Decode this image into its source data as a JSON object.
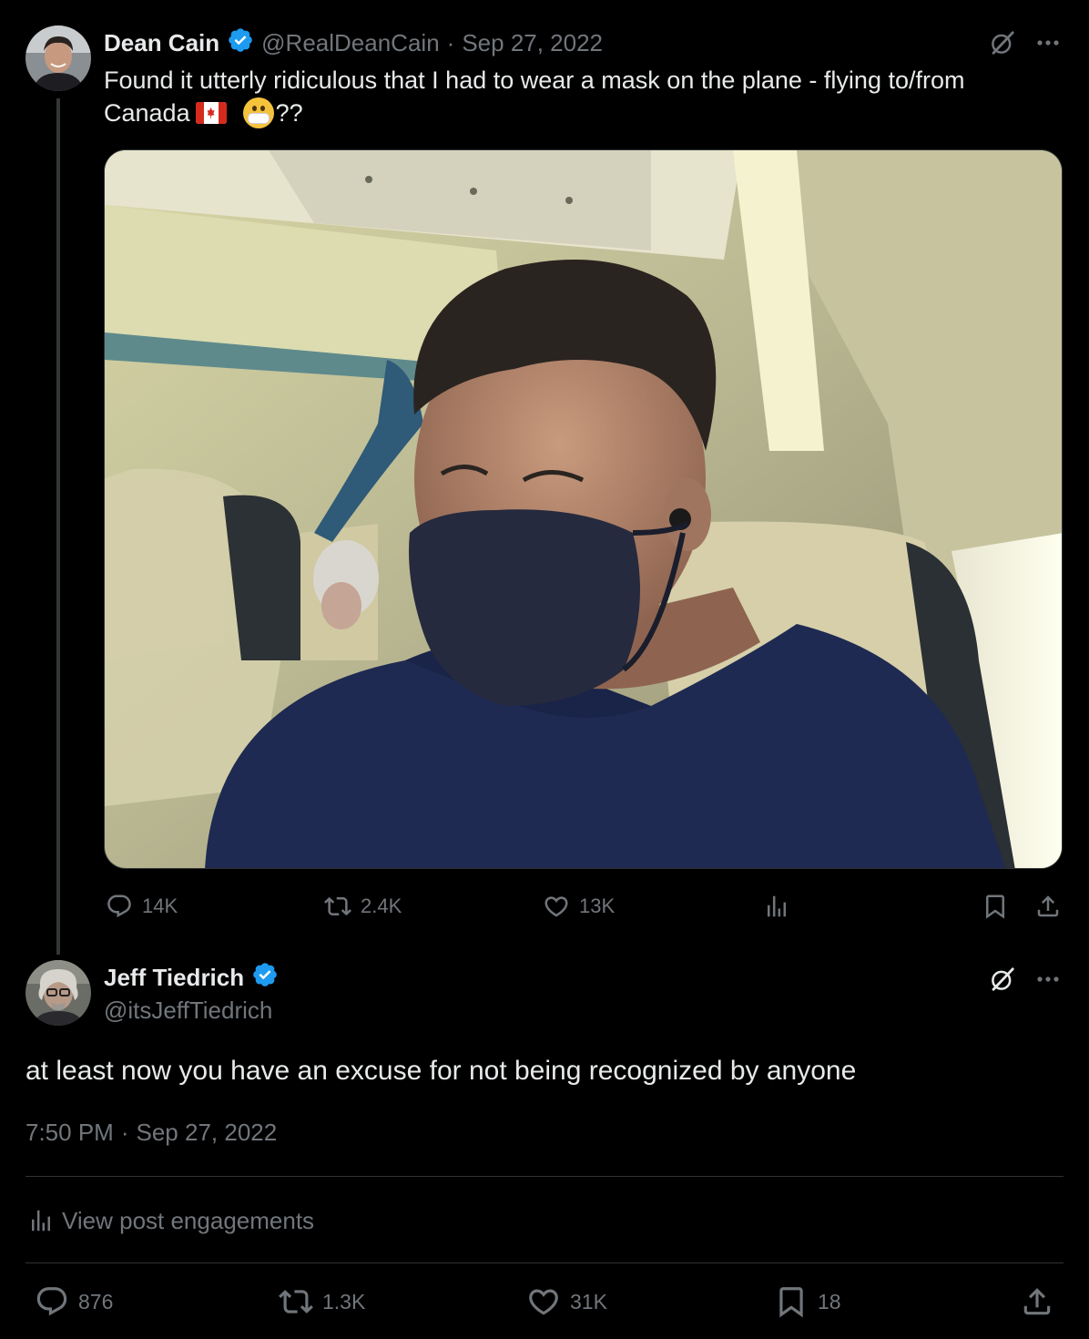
{
  "parent_tweet": {
    "display_name": "Dean Cain",
    "handle": "@RealDeanCain",
    "separator": "·",
    "date": "Sep 27, 2022",
    "text_line1": "Found it utterly ridiculous that I had to wear a mask on the plane - flying to/from",
    "text_line2_prefix": "Canada",
    "text_line2_suffix": "??",
    "actions": {
      "replies": "14K",
      "reposts": "2.4K",
      "likes": "13K"
    }
  },
  "reply_tweet": {
    "display_name": "Jeff Tiedrich",
    "handle": "@itsJeffTiedrich",
    "text": "at least now you have an excuse for not being recognized by anyone",
    "time": "7:50 PM",
    "separator": "·",
    "date": "Sep 27, 2022",
    "engagements_link": "View post engagements",
    "actions": {
      "replies": "876",
      "reposts": "1.3K",
      "likes": "31K",
      "bookmarks": "18"
    }
  },
  "colors": {
    "background": "#000000",
    "text": "#e7e9ea",
    "muted": "#71767b",
    "verified": "#1d9bf0",
    "divider": "#2f3336"
  },
  "icons": [
    "verified-badge-icon",
    "grok-icon",
    "more-icon",
    "reply-icon",
    "repost-icon",
    "like-icon",
    "views-icon",
    "bookmark-icon",
    "share-icon",
    "analytics-icon"
  ]
}
